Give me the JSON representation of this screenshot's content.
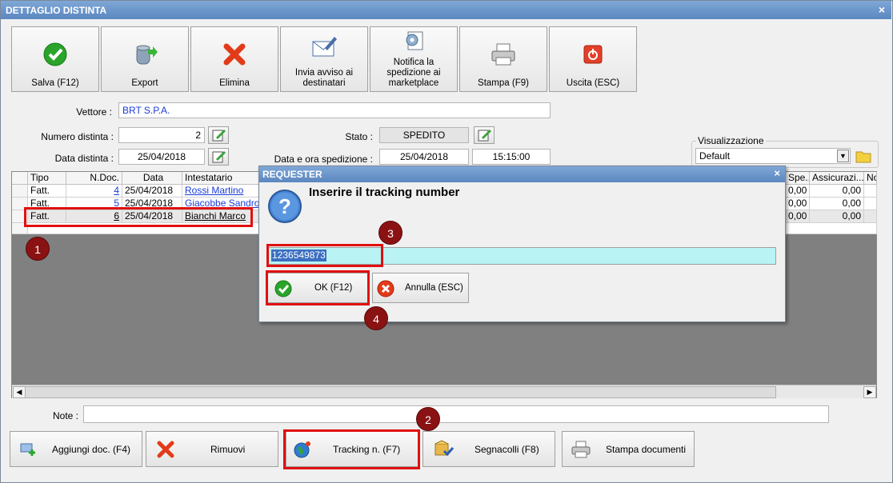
{
  "window": {
    "title": "DETTAGLIO DISTINTA",
    "close": "×"
  },
  "toolbar": [
    {
      "label": "Salva (F12)",
      "icon": "check-icon"
    },
    {
      "label": "Export",
      "icon": "database-export-icon"
    },
    {
      "label": "Elimina",
      "icon": "delete-x-icon"
    },
    {
      "label": "Invia avviso ai destinatari",
      "icon": "mail-icon"
    },
    {
      "label": "Notifica la spedizione ai marketplace",
      "icon": "gear-doc-icon"
    },
    {
      "label": "Stampa (F9)",
      "icon": "printer-icon"
    },
    {
      "label": "Uscita (ESC)",
      "icon": "power-icon"
    }
  ],
  "form": {
    "vettore_label": "Vettore :",
    "vettore_value": "BRT S.P.A.",
    "numero_label": "Numero distinta :",
    "numero_value": "2",
    "data_label": "Data distinta :",
    "data_value": "25/04/2018",
    "stato_label": "Stato :",
    "stato_value": "SPEDITO",
    "spedizione_label": "Data e ora spedizione :",
    "spedizione_date": "25/04/2018",
    "spedizione_time": "15:15:00",
    "visual_label": "Visualizzazione",
    "visual_value": "Default"
  },
  "grid": {
    "columns": [
      "Tipo",
      "N.Doc.",
      "Data",
      "Intestatario"
    ],
    "right_columns": [
      "Spe...",
      "Assicurazi...",
      "No"
    ],
    "rows": [
      {
        "tipo": "Fatt.",
        "ndoc": "4",
        "data": "25/04/2018",
        "intestatario": "Rossi Martino",
        "spe": "0,00",
        "ass": "0,00"
      },
      {
        "tipo": "Fatt.",
        "ndoc": "5",
        "data": "25/04/2018",
        "intestatario": "Giacobbe Sandro",
        "spe": "0,00",
        "ass": "0,00"
      },
      {
        "tipo": "Fatt.",
        "ndoc": "6",
        "data": "25/04/2018",
        "intestatario": "Bianchi Marco",
        "spe": "0,00",
        "ass": "0,00"
      }
    ]
  },
  "note_label": "Note :",
  "bottom_buttons": [
    {
      "label": "Aggiungi doc. (F4)",
      "icon": "add-doc-icon"
    },
    {
      "label": "Rimuovi",
      "icon": "remove-x-icon"
    },
    {
      "label": "Tracking n. (F7)",
      "icon": "globe-icon"
    },
    {
      "label": "Segnacolli (F8)",
      "icon": "package-icon"
    },
    {
      "label": "Stampa documenti",
      "icon": "printer-icon"
    }
  ],
  "dialog": {
    "title": "REQUESTER",
    "close": "×",
    "message": "Inserire il tracking number",
    "input_value": "1236549873",
    "ok_label": "OK (F12)",
    "cancel_label": "Annulla (ESC)"
  },
  "callouts": [
    "1",
    "2",
    "3",
    "4"
  ],
  "colors": {
    "title_bar": "#5b87c0",
    "highlight": "#e01010",
    "badge": "#8a1212",
    "input_bg": "#b9f3f3"
  }
}
